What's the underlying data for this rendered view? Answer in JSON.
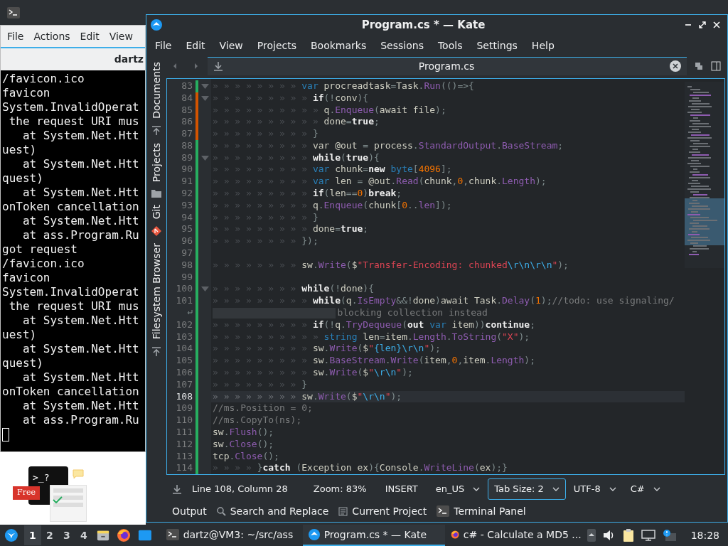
{
  "terminal": {
    "menu": [
      "File",
      "Actions",
      "Edit",
      "View"
    ],
    "tab_title": "dartz",
    "lines": [
      "/favicon.ico",
      "favicon",
      "System.InvalidOperat",
      " the request URI mus",
      "   at System.Net.Htt",
      "uest)",
      "   at System.Net.Htt",
      "quest)",
      "   at System.Net.Htt",
      "onToken cancellation",
      "   at System.Net.Htt",
      "   at ass.Program.Ru",
      "got request",
      "/favicon.ico",
      "favicon",
      "System.InvalidOperat",
      " the request URI mus",
      "   at System.Net.Htt",
      "uest)",
      "   at System.Net.Htt",
      "quest)",
      "   at System.Net.Htt",
      "onToken cancellation",
      "   at System.Net.Htt",
      "   at ass.Program.Ru"
    ]
  },
  "promo": {
    "prompt": ">_?",
    "badge": "Free"
  },
  "kate": {
    "title": "Program.cs * — Kate",
    "menu": [
      "File",
      "Edit",
      "View",
      "Projects",
      "Bookmarks",
      "Sessions",
      "Tools",
      "Settings",
      "Help"
    ],
    "sidebar_tabs": [
      {
        "label": "Documents",
        "kind": "upload"
      },
      {
        "label": "Projects",
        "kind": "folder"
      },
      {
        "label": "Git",
        "kind": "git"
      },
      {
        "label": "Filesystem Browser",
        "kind": "upload"
      }
    ],
    "document_tab": "Program.cs",
    "lines": [
      {
        "kind": "code",
        "number": "83",
        "fold": true,
        "modified": false,
        "current": false,
        "indent": "» » » » » » » » ",
        "tokens": [
          {
            "kind": "t",
            "text": "var"
          },
          {
            "kind": "p",
            "text": " procreadtask"
          },
          {
            "kind": "o",
            "text": "="
          },
          {
            "kind": "p",
            "text": "Task"
          },
          {
            "kind": "o",
            "text": "."
          },
          {
            "kind": "f",
            "text": "Run"
          },
          {
            "kind": "o",
            "text": "(()=>{"
          }
        ]
      },
      {
        "kind": "code",
        "number": "84",
        "fold": true,
        "modified": true,
        "current": false,
        "indent": "» » » » » » » » » ",
        "tokens": [
          {
            "kind": "k",
            "text": "if"
          },
          {
            "kind": "o",
            "text": "(!"
          },
          {
            "kind": "p",
            "text": "conv"
          },
          {
            "kind": "o",
            "text": "){"
          }
        ]
      },
      {
        "kind": "code",
        "number": "85",
        "fold": false,
        "modified": true,
        "current": false,
        "indent": "» » » » » » » » » » ",
        "tokens": [
          {
            "kind": "p",
            "text": "q"
          },
          {
            "kind": "o",
            "text": "."
          },
          {
            "kind": "f",
            "text": "Enqueue"
          },
          {
            "kind": "o",
            "text": "("
          },
          {
            "kind": "p",
            "text": "await file"
          },
          {
            "kind": "o",
            "text": ");"
          }
        ]
      },
      {
        "kind": "code",
        "number": "86",
        "fold": false,
        "modified": true,
        "current": false,
        "indent": "» » » » » » » » » » ",
        "tokens": [
          {
            "kind": "p",
            "text": "done"
          },
          {
            "kind": "o",
            "text": "="
          },
          {
            "kind": "k",
            "text": "true"
          },
          {
            "kind": "o",
            "text": ";"
          }
        ]
      },
      {
        "kind": "code",
        "number": "87",
        "fold": false,
        "modified": true,
        "current": false,
        "indent": "» » » » » » » » » ",
        "tokens": [
          {
            "kind": "o",
            "text": "}"
          }
        ]
      },
      {
        "kind": "code",
        "number": "88",
        "fold": false,
        "modified": false,
        "current": false,
        "indent": "» » » » » » » » » ",
        "tokens": [
          {
            "kind": "p",
            "text": "var @out "
          },
          {
            "kind": "o",
            "text": "="
          },
          {
            "kind": "p",
            "text": " process"
          },
          {
            "kind": "o",
            "text": "."
          },
          {
            "kind": "f",
            "text": "StandardOutput"
          },
          {
            "kind": "o",
            "text": "."
          },
          {
            "kind": "f",
            "text": "BaseStream"
          },
          {
            "kind": "o",
            "text": ";"
          }
        ]
      },
      {
        "kind": "code",
        "number": "89",
        "fold": true,
        "modified": false,
        "current": false,
        "indent": "» » » » » » » » » ",
        "tokens": [
          {
            "kind": "k",
            "text": "while"
          },
          {
            "kind": "o",
            "text": "("
          },
          {
            "kind": "k",
            "text": "true"
          },
          {
            "kind": "o",
            "text": "){"
          }
        ]
      },
      {
        "kind": "code",
        "number": "90",
        "fold": false,
        "modified": false,
        "current": false,
        "indent": "» » » » » » » » » ",
        "tokens": [
          {
            "kind": "t",
            "text": "var"
          },
          {
            "kind": "p",
            "text": " chunk"
          },
          {
            "kind": "o",
            "text": "="
          },
          {
            "kind": "k",
            "text": "new"
          },
          {
            "kind": "t",
            "text": " byte"
          },
          {
            "kind": "o",
            "text": "["
          },
          {
            "kind": "n",
            "text": "4096"
          },
          {
            "kind": "o",
            "text": "];"
          }
        ]
      },
      {
        "kind": "code",
        "number": "91",
        "fold": false,
        "modified": false,
        "current": false,
        "indent": "» » » » » » » » » ",
        "tokens": [
          {
            "kind": "t",
            "text": "var"
          },
          {
            "kind": "p",
            "text": " len "
          },
          {
            "kind": "o",
            "text": "="
          },
          {
            "kind": "p",
            "text": " @out"
          },
          {
            "kind": "o",
            "text": "."
          },
          {
            "kind": "f",
            "text": "Read"
          },
          {
            "kind": "o",
            "text": "("
          },
          {
            "kind": "p",
            "text": "chunk"
          },
          {
            "kind": "o",
            "text": ","
          },
          {
            "kind": "n",
            "text": "0"
          },
          {
            "kind": "o",
            "text": ","
          },
          {
            "kind": "p",
            "text": "chunk"
          },
          {
            "kind": "o",
            "text": "."
          },
          {
            "kind": "f",
            "text": "Length"
          },
          {
            "kind": "o",
            "text": ");"
          }
        ]
      },
      {
        "kind": "code",
        "number": "92",
        "fold": false,
        "modified": false,
        "current": false,
        "indent": "» » » » » » » » » ",
        "tokens": [
          {
            "kind": "k",
            "text": "if"
          },
          {
            "kind": "o",
            "text": "("
          },
          {
            "kind": "p",
            "text": "len"
          },
          {
            "kind": "o",
            "text": "=="
          },
          {
            "kind": "n",
            "text": "0"
          },
          {
            "kind": "o",
            "text": ")"
          },
          {
            "kind": "k",
            "text": "break"
          },
          {
            "kind": "o",
            "text": ";"
          }
        ]
      },
      {
        "kind": "code",
        "number": "93",
        "fold": false,
        "modified": false,
        "current": false,
        "indent": "» » » » » » » » » ",
        "tokens": [
          {
            "kind": "p",
            "text": "q"
          },
          {
            "kind": "o",
            "text": "."
          },
          {
            "kind": "f",
            "text": "Enqueue"
          },
          {
            "kind": "o",
            "text": "("
          },
          {
            "kind": "p",
            "text": "chunk"
          },
          {
            "kind": "o",
            "text": "["
          },
          {
            "kind": "n",
            "text": "0"
          },
          {
            "kind": "o",
            "text": ".."
          },
          {
            "kind": "f",
            "text": "len"
          },
          {
            "kind": "o",
            "text": "]);"
          }
        ]
      },
      {
        "kind": "code",
        "number": "94",
        "fold": false,
        "modified": false,
        "current": false,
        "indent": "» » » » » » » » » ",
        "tokens": [
          {
            "kind": "o",
            "text": "}"
          }
        ]
      },
      {
        "kind": "code",
        "number": "95",
        "fold": false,
        "modified": false,
        "current": false,
        "indent": "» » » » » » » » » ",
        "tokens": [
          {
            "kind": "p",
            "text": "done"
          },
          {
            "kind": "o",
            "text": "="
          },
          {
            "kind": "k",
            "text": "true"
          },
          {
            "kind": "o",
            "text": ";"
          }
        ]
      },
      {
        "kind": "code",
        "number": "96",
        "fold": false,
        "modified": false,
        "current": false,
        "indent": "» » » » » » » » ",
        "tokens": [
          {
            "kind": "o",
            "text": "});"
          }
        ]
      },
      {
        "kind": "code",
        "number": "97",
        "fold": false,
        "modified": false,
        "current": false
      },
      {
        "kind": "code",
        "number": "98",
        "fold": false,
        "modified": false,
        "current": false,
        "indent": "» » » » » » » » ",
        "tokens": [
          {
            "kind": "p",
            "text": "sw"
          },
          {
            "kind": "o",
            "text": "."
          },
          {
            "kind": "f",
            "text": "Write"
          },
          {
            "kind": "o",
            "text": "("
          },
          {
            "kind": "p",
            "text": "$"
          },
          {
            "kind": "s",
            "text": "\"Transfer-Encoding: chunked"
          },
          {
            "kind": "e",
            "text": "\\r\\n\\r\\n"
          },
          {
            "kind": "s",
            "text": "\""
          },
          {
            "kind": "o",
            "text": ");"
          }
        ]
      },
      {
        "kind": "code",
        "number": "99",
        "fold": false,
        "modified": false,
        "current": false
      },
      {
        "kind": "code",
        "number": "100",
        "fold": true,
        "modified": false,
        "current": false,
        "indent": "» » » » » » » » ",
        "tokens": [
          {
            "kind": "k",
            "text": "while"
          },
          {
            "kind": "o",
            "text": "(!"
          },
          {
            "kind": "p",
            "text": "done"
          },
          {
            "kind": "o",
            "text": "){"
          }
        ]
      },
      {
        "kind": "code",
        "number": "101",
        "fold": false,
        "modified": false,
        "current": false,
        "indent": "» » » » » » » » » ",
        "tokens": [
          {
            "kind": "k",
            "text": "while"
          },
          {
            "kind": "o",
            "text": "("
          },
          {
            "kind": "p",
            "text": "q"
          },
          {
            "kind": "o",
            "text": "."
          },
          {
            "kind": "f",
            "text": "IsEmpty"
          },
          {
            "kind": "o",
            "text": "&&!"
          },
          {
            "kind": "p",
            "text": "done"
          },
          {
            "kind": "o",
            "text": ")"
          },
          {
            "kind": "p",
            "text": "await Task"
          },
          {
            "kind": "o",
            "text": "."
          },
          {
            "kind": "f",
            "text": "Delay"
          },
          {
            "kind": "o",
            "text": "("
          },
          {
            "kind": "n",
            "text": "1"
          },
          {
            "kind": "o",
            "text": ");"
          },
          {
            "kind": "c",
            "text": "//todo: use signaling/"
          }
        ]
      },
      {
        "kind": "wrap",
        "fold": false,
        "modified": false,
        "current": false,
        "tokens": [
          {
            "kind": "c",
            "text": "blocking collection instead"
          }
        ]
      },
      {
        "kind": "code",
        "number": "102",
        "fold": false,
        "modified": false,
        "current": false,
        "indent": "» » » » » » » » » ",
        "tokens": [
          {
            "kind": "k",
            "text": "if"
          },
          {
            "kind": "o",
            "text": "(!"
          },
          {
            "kind": "p",
            "text": "q"
          },
          {
            "kind": "o",
            "text": "."
          },
          {
            "kind": "f",
            "text": "TryDequeue"
          },
          {
            "kind": "o",
            "text": "("
          },
          {
            "kind": "k",
            "text": "out"
          },
          {
            "kind": "t",
            "text": " var"
          },
          {
            "kind": "p",
            "text": " item"
          },
          {
            "kind": "o",
            "text": "))"
          },
          {
            "kind": "k",
            "text": "continue"
          },
          {
            "kind": "o",
            "text": ";"
          }
        ]
      },
      {
        "kind": "code",
        "number": "103",
        "fold": false,
        "modified": false,
        "current": false,
        "indent": "» » » » » » » » » » ",
        "tokens": [
          {
            "kind": "t",
            "text": "string"
          },
          {
            "kind": "p",
            "text": " len"
          },
          {
            "kind": "o",
            "text": "="
          },
          {
            "kind": "p",
            "text": "item"
          },
          {
            "kind": "o",
            "text": "."
          },
          {
            "kind": "f",
            "text": "Length"
          },
          {
            "kind": "o",
            "text": "."
          },
          {
            "kind": "f",
            "text": "ToString"
          },
          {
            "kind": "o",
            "text": "("
          },
          {
            "kind": "s",
            "text": "\"X\""
          },
          {
            "kind": "o",
            "text": ");"
          }
        ]
      },
      {
        "kind": "code",
        "number": "104",
        "fold": false,
        "modified": false,
        "current": false,
        "indent": "» » » » » » » » » ",
        "tokens": [
          {
            "kind": "p",
            "text": "sw"
          },
          {
            "kind": "o",
            "text": "."
          },
          {
            "kind": "f",
            "text": "Write"
          },
          {
            "kind": "o",
            "text": "("
          },
          {
            "kind": "p",
            "text": "$"
          },
          {
            "kind": "s",
            "text": "\""
          },
          {
            "kind": "e",
            "text": "{len}\\r\\n"
          },
          {
            "kind": "s",
            "text": "\""
          },
          {
            "kind": "o",
            "text": ");"
          }
        ]
      },
      {
        "kind": "code",
        "number": "105",
        "fold": false,
        "modified": false,
        "current": false,
        "indent": "» » » » » » » » » ",
        "tokens": [
          {
            "kind": "p",
            "text": "sw"
          },
          {
            "kind": "o",
            "text": "."
          },
          {
            "kind": "f",
            "text": "BaseStream"
          },
          {
            "kind": "o",
            "text": "."
          },
          {
            "kind": "f",
            "text": "Write"
          },
          {
            "kind": "o",
            "text": "("
          },
          {
            "kind": "p",
            "text": "item"
          },
          {
            "kind": "o",
            "text": ","
          },
          {
            "kind": "n",
            "text": "0"
          },
          {
            "kind": "o",
            "text": ","
          },
          {
            "kind": "p",
            "text": "item"
          },
          {
            "kind": "o",
            "text": "."
          },
          {
            "kind": "f",
            "text": "Length"
          },
          {
            "kind": "o",
            "text": ");"
          }
        ]
      },
      {
        "kind": "code",
        "number": "106",
        "fold": false,
        "modified": false,
        "current": false,
        "indent": "» » » » » » » » » ",
        "tokens": [
          {
            "kind": "p",
            "text": "sw"
          },
          {
            "kind": "o",
            "text": "."
          },
          {
            "kind": "f",
            "text": "Write"
          },
          {
            "kind": "o",
            "text": "("
          },
          {
            "kind": "p",
            "text": "$"
          },
          {
            "kind": "s",
            "text": "\""
          },
          {
            "kind": "e",
            "text": "\\r\\n"
          },
          {
            "kind": "s",
            "text": "\""
          },
          {
            "kind": "o",
            "text": ");"
          }
        ]
      },
      {
        "kind": "code",
        "number": "107",
        "fold": false,
        "modified": false,
        "current": false,
        "indent": "» » » » » » » » ",
        "tokens": [
          {
            "kind": "o",
            "text": "}"
          }
        ]
      },
      {
        "kind": "code",
        "number": "108",
        "fold": false,
        "modified": false,
        "current": true,
        "indent": "» » » » » » » » ",
        "tokens": [
          {
            "kind": "p",
            "text": "sw"
          },
          {
            "kind": "o",
            "text": "."
          },
          {
            "kind": "f",
            "text": "Write"
          },
          {
            "kind": "o",
            "text": "("
          },
          {
            "kind": "p",
            "text": "$"
          },
          {
            "kind": "s",
            "text": "\""
          },
          {
            "kind": "e",
            "text": "\\r\\n"
          },
          {
            "kind": "s",
            "text": "\""
          },
          {
            "kind": "o",
            "text": ");"
          }
        ]
      },
      {
        "kind": "code",
        "number": "109",
        "fold": false,
        "modified": false,
        "current": false,
        "tokens": [
          {
            "kind": "c",
            "text": "//ms.Position = 0;"
          }
        ]
      },
      {
        "kind": "code",
        "number": "110",
        "fold": false,
        "modified": false,
        "current": false,
        "tokens": [
          {
            "kind": "c",
            "text": "//ms.CopyTo(ns);"
          }
        ]
      },
      {
        "kind": "code",
        "number": "111",
        "fold": false,
        "modified": false,
        "current": false,
        "tokens": [
          {
            "kind": "p",
            "text": "sw"
          },
          {
            "kind": "o",
            "text": "."
          },
          {
            "kind": "f",
            "text": "Flush"
          },
          {
            "kind": "o",
            "text": "();"
          }
        ]
      },
      {
        "kind": "code",
        "number": "112",
        "fold": false,
        "modified": false,
        "current": false,
        "tokens": [
          {
            "kind": "p",
            "text": "sw"
          },
          {
            "kind": "o",
            "text": "."
          },
          {
            "kind": "f",
            "text": "Close"
          },
          {
            "kind": "o",
            "text": "();"
          }
        ]
      },
      {
        "kind": "code",
        "number": "113",
        "fold": false,
        "modified": false,
        "current": false,
        "tokens": [
          {
            "kind": "p",
            "text": "tcp"
          },
          {
            "kind": "o",
            "text": "."
          },
          {
            "kind": "f",
            "text": "Close"
          },
          {
            "kind": "o",
            "text": "();"
          }
        ]
      },
      {
        "kind": "code",
        "number": "114",
        "fold": false,
        "modified": false,
        "current": false,
        "indent": "» » » » ",
        "tokens": [
          {
            "kind": "o",
            "text": "}"
          },
          {
            "kind": "k",
            "text": "catch"
          },
          {
            "kind": "o",
            "text": " ("
          },
          {
            "kind": "p",
            "text": "Exception ex"
          },
          {
            "kind": "o",
            "text": "){"
          },
          {
            "kind": "p",
            "text": "Console"
          },
          {
            "kind": "o",
            "text": "."
          },
          {
            "kind": "f",
            "text": "WriteLine"
          },
          {
            "kind": "o",
            "text": "("
          },
          {
            "kind": "p",
            "text": "ex"
          },
          {
            "kind": "o",
            "text": ");}"
          }
        ]
      }
    ],
    "status": {
      "position": "Line 108, Column 28",
      "zoom": "Zoom: 83%",
      "mode": "INSERT",
      "dropdowns": [
        {
          "label": "en_US",
          "focused": false
        },
        {
          "label": "Tab Size: 2",
          "focused": true
        },
        {
          "label": "UTF-8",
          "focused": false
        },
        {
          "label": "C#",
          "focused": false
        }
      ]
    },
    "tool_views": [
      {
        "label": "Output",
        "kind": "plain"
      },
      {
        "label": "Search and Replace",
        "kind": "search"
      },
      {
        "label": "Current Project",
        "kind": "project"
      },
      {
        "label": "Terminal Panel",
        "kind": "terminal"
      }
    ]
  },
  "taskbar": {
    "desktops": [
      {
        "label": "1",
        "selected": true
      },
      {
        "label": "2",
        "selected": false
      },
      {
        "label": "3",
        "selected": false
      },
      {
        "label": "4",
        "selected": false
      }
    ],
    "tasks": [
      {
        "label": "dartz@VM3: ~/src/ass",
        "kind": "terminal",
        "selected": false
      },
      {
        "label": "Program.cs * — Kate",
        "kind": "kate",
        "selected": true
      },
      {
        "label": "c# - Calculate a MD5 ...",
        "kind": "firefox",
        "selected": false
      }
    ],
    "clock": "18:28"
  }
}
